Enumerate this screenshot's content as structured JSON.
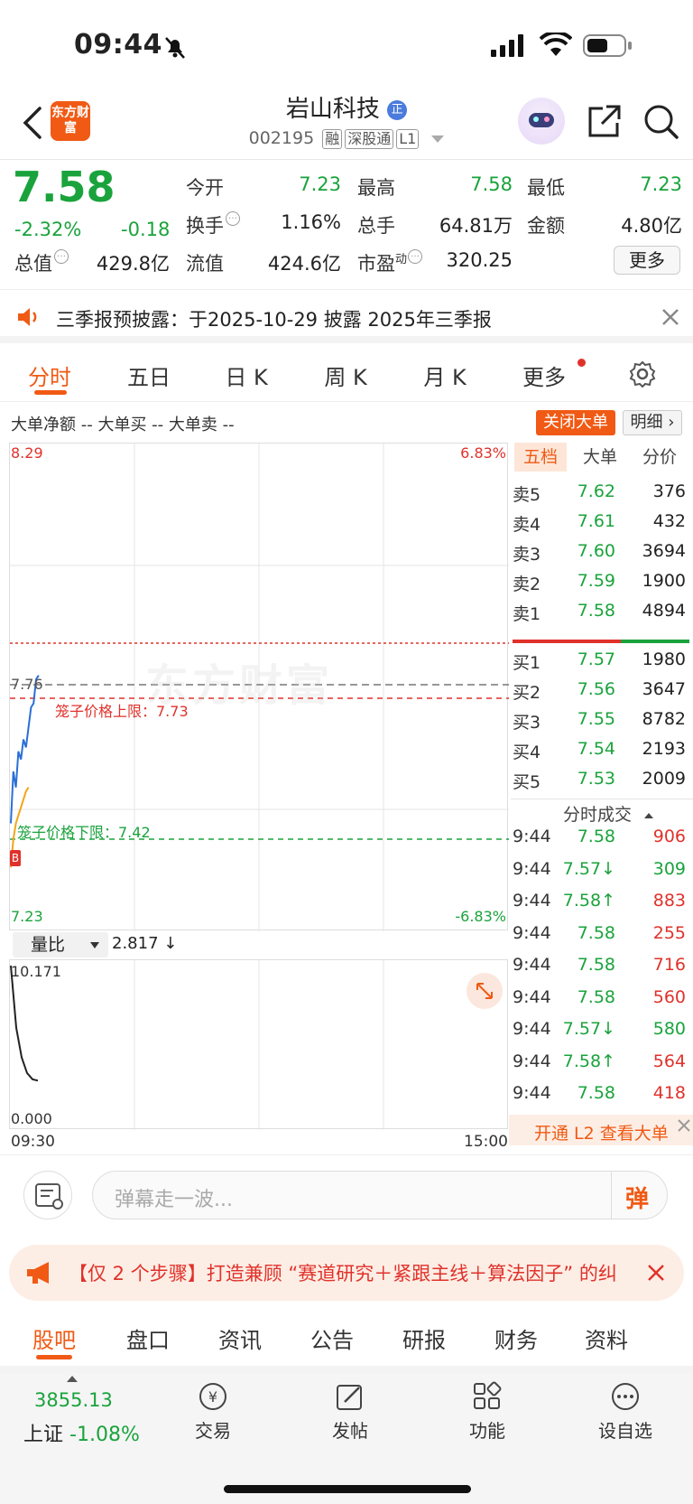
{
  "status_bar": {
    "time": "09:44"
  },
  "header": {
    "title": "岩山科技",
    "code": "002195",
    "tags": [
      "融",
      "深股通",
      "L1"
    ],
    "logo_text": "东方财富"
  },
  "quote": {
    "price": "7.58",
    "change_pct": "-2.32%",
    "change": "-0.18",
    "open_label": "今开",
    "open": "7.23",
    "high_label": "最高",
    "high": "7.58",
    "low_label": "最低",
    "low": "7.23",
    "turnover_label": "换手",
    "turnover": "1.16%",
    "volume_label": "总手",
    "volume": "64.81万",
    "amount_label": "金额",
    "amount": "4.80亿",
    "mktcap_label": "总值",
    "mktcap": "429.8亿",
    "float_label": "流值",
    "float": "424.6亿",
    "pe_label": "市盈",
    "pe_sup": "动",
    "pe": "320.25",
    "more_label": "更多"
  },
  "notice": {
    "text": "三季报预披露：于2025-10-29 披露 2025年三季报"
  },
  "tabs": [
    "分时",
    "五日",
    "日 K",
    "周 K",
    "月 K",
    "更多"
  ],
  "legend": {
    "net": "大单净额 --",
    "buy": "大单买 --",
    "sell": "大单卖 --",
    "close_btn": "关闭大单",
    "detail_btn": "明细 ›"
  },
  "chart": {
    "top_price": "8.29",
    "top_pct": "6.83%",
    "ref_price": "7.76",
    "upper_cage": "笼子价格上限：7.73",
    "lower_cage": "笼子价格下限：7.42",
    "bottom_price": "7.23",
    "bottom_pct": "-6.83%",
    "b_marker": "B",
    "watermark": "东方财富",
    "ratio_select": "量比",
    "ratio_value": "2.817 ↓",
    "ratio_top": "10.171",
    "ratio_bottom": "0.000",
    "time_start": "09:30",
    "time_end": "15:00",
    "price_line": [
      [
        0,
        7.34
      ],
      [
        1,
        7.47
      ],
      [
        2,
        7.43
      ],
      [
        3,
        7.52
      ],
      [
        4,
        7.5
      ],
      [
        5,
        7.55
      ],
      [
        6,
        7.53
      ],
      [
        7,
        7.58
      ],
      [
        8,
        7.63
      ],
      [
        9,
        7.64
      ],
      [
        10,
        7.7
      ],
      [
        11,
        7.71
      ]
    ],
    "avg_line": [
      [
        0,
        7.23
      ],
      [
        1,
        7.3
      ],
      [
        2,
        7.34
      ],
      [
        3,
        7.36
      ],
      [
        4,
        7.38
      ],
      [
        5,
        7.4
      ],
      [
        6,
        7.42
      ],
      [
        7,
        7.43
      ]
    ],
    "ratio_line": [
      [
        0,
        10.17
      ],
      [
        1,
        6.2
      ],
      [
        2,
        4.3
      ],
      [
        3,
        3.3
      ],
      [
        4,
        2.9
      ],
      [
        5,
        2.817
      ]
    ]
  },
  "orderbook": {
    "tabs": [
      "五档",
      "大单",
      "分价"
    ],
    "asks": [
      {
        "label": "卖5",
        "price": "7.62",
        "vol": "376"
      },
      {
        "label": "卖4",
        "price": "7.61",
        "vol": "432"
      },
      {
        "label": "卖3",
        "price": "7.60",
        "vol": "3694"
      },
      {
        "label": "卖2",
        "price": "7.59",
        "vol": "1900"
      },
      {
        "label": "卖1",
        "price": "7.58",
        "vol": "4894"
      }
    ],
    "bids": [
      {
        "label": "买1",
        "price": "7.57",
        "vol": "1980"
      },
      {
        "label": "买2",
        "price": "7.56",
        "vol": "3647"
      },
      {
        "label": "买3",
        "price": "7.55",
        "vol": "8782"
      },
      {
        "label": "买4",
        "price": "7.54",
        "vol": "2193"
      },
      {
        "label": "买5",
        "price": "7.53",
        "vol": "2009"
      }
    ],
    "trades_title": "分时成交",
    "trades": [
      {
        "time": "9:44",
        "price": "7.58",
        "vol": "906",
        "arrow": "",
        "vcolor": "red"
      },
      {
        "time": "9:44",
        "price": "7.57↓",
        "vol": "309",
        "arrow": "",
        "vcolor": "green"
      },
      {
        "time": "9:44",
        "price": "7.58↑",
        "vol": "883",
        "arrow": "",
        "vcolor": "red"
      },
      {
        "time": "9:44",
        "price": "7.58",
        "vol": "255",
        "arrow": "",
        "vcolor": "red"
      },
      {
        "time": "9:44",
        "price": "7.58",
        "vol": "716",
        "arrow": "",
        "vcolor": "red"
      },
      {
        "time": "9:44",
        "price": "7.58",
        "vol": "560",
        "arrow": "",
        "vcolor": "red"
      },
      {
        "time": "9:44",
        "price": "7.57↓",
        "vol": "580",
        "arrow": "",
        "vcolor": "green"
      },
      {
        "time": "9:44",
        "price": "7.58↑",
        "vol": "564",
        "arrow": "",
        "vcolor": "red"
      },
      {
        "time": "9:44",
        "price": "7.58",
        "vol": "418",
        "arrow": "",
        "vcolor": "red"
      }
    ],
    "l2_banner": "开通 L2 查看大单"
  },
  "comment": {
    "placeholder": "弹幕走一波...",
    "danmu_label": "弹"
  },
  "promo": {
    "text": "【仅 2 个步骤】打造兼顾 “赛道研究＋紧跟主线＋算法因子” 的纠"
  },
  "bottom_tabs": [
    "股吧",
    "盘口",
    "资讯",
    "公告",
    "研报",
    "财务",
    "资料"
  ],
  "nav": {
    "index_value": "3855.13",
    "index_name": "上证",
    "index_change": "-1.08%",
    "items": [
      "交易",
      "发帖",
      "功能",
      "设自选"
    ]
  },
  "colors": {
    "accent": "#f05a14",
    "up": "#e0322b",
    "down": "#1aa33c",
    "blue_line": "#2a6fd6",
    "avg_line": "#f2a51a"
  }
}
